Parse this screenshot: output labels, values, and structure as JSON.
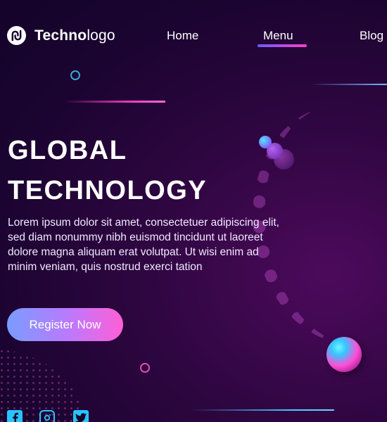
{
  "header": {
    "logo_bold": "Techno",
    "logo_light": "logo",
    "nav": {
      "home": "Home",
      "menu": "Menu",
      "blog": "Blog"
    },
    "active_nav": "Menu"
  },
  "hero": {
    "title_line1": "GLOBAL",
    "title_line2": "TECHNOLOGY",
    "body": "Lorem ipsum dolor sit amet, consectetuer adipiscing elit, sed diam nonummy nibh euismod tincidunt ut laoreet dolore magna aliquam erat volutpat. Ut wisi enim ad minim veniam, quis nostrud exerci tation",
    "cta_label": "Register Now"
  },
  "social": {
    "icons": [
      "facebook-icon",
      "instagram-icon",
      "twitter-icon"
    ],
    "color": "#29c3ff"
  },
  "colors": {
    "background": "#1a0430",
    "accent_pink": "#ff3fc6",
    "accent_blue": "#48c8ff",
    "text": "#ffffff"
  }
}
